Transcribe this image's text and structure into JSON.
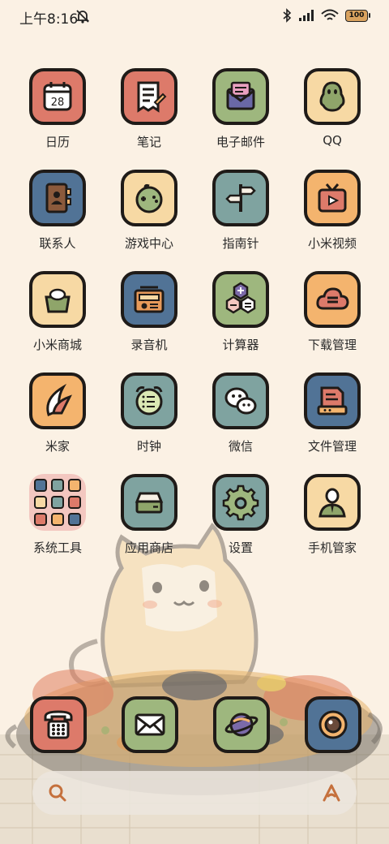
{
  "status_bar": {
    "time": "上午8:16",
    "battery": "100",
    "icons": [
      "bell-muted-icon",
      "bluetooth-icon",
      "signal-icon",
      "wifi-icon",
      "battery-icon"
    ]
  },
  "apps": [
    {
      "label": "日历",
      "icon": "calendar-icon",
      "color": "#dd7a6a",
      "detail": "28"
    },
    {
      "label": "笔记",
      "icon": "notes-icon",
      "color": "#dd7a6a"
    },
    {
      "label": "电子邮件",
      "icon": "email-icon",
      "color": "#9eb77e"
    },
    {
      "label": "QQ",
      "icon": "qq-icon",
      "color": "#f7d9a4"
    },
    {
      "label": "联系人",
      "icon": "contacts-icon",
      "color": "#517396"
    },
    {
      "label": "游戏中心",
      "icon": "gamepad-icon",
      "color": "#f7d9a4"
    },
    {
      "label": "指南针",
      "icon": "signpost-icon",
      "color": "#7fa3a0"
    },
    {
      "label": "小米视频",
      "icon": "tv-icon",
      "color": "#f4b46e"
    },
    {
      "label": "小米商城",
      "icon": "shopping-bag-icon",
      "color": "#f7d9a4"
    },
    {
      "label": "录音机",
      "icon": "radio-icon",
      "color": "#517396"
    },
    {
      "label": "计算器",
      "icon": "calculator-icon",
      "color": "#9eb77e"
    },
    {
      "label": "下载管理",
      "icon": "cloud-download-icon",
      "color": "#f4b46e"
    },
    {
      "label": "米家",
      "icon": "mijia-leaf-icon",
      "color": "#f4b46e"
    },
    {
      "label": "时钟",
      "icon": "clock-icon",
      "color": "#7fa3a0"
    },
    {
      "label": "微信",
      "icon": "wechat-icon",
      "color": "#7fa3a0"
    },
    {
      "label": "文件管理",
      "icon": "file-manager-icon",
      "color": "#517396"
    },
    {
      "label": "系统工具",
      "icon": "folder-icon",
      "color": "#f3c7c0"
    },
    {
      "label": "应用商店",
      "icon": "app-store-icon",
      "color": "#7fa3a0"
    },
    {
      "label": "设置",
      "icon": "gear-icon",
      "color": "#7fa3a0"
    },
    {
      "label": "手机管家",
      "icon": "security-icon",
      "color": "#f7d9a4"
    }
  ],
  "dock": [
    {
      "icon": "phone-icon",
      "color": "#dd7a6a"
    },
    {
      "icon": "messages-icon",
      "color": "#9eb77e"
    },
    {
      "icon": "browser-planet-icon",
      "color": "#9eb77e"
    },
    {
      "icon": "camera-icon",
      "color": "#517396"
    }
  ],
  "search_bar": {
    "left_icon": "search-icon",
    "right_icon": "assistant-icon"
  }
}
